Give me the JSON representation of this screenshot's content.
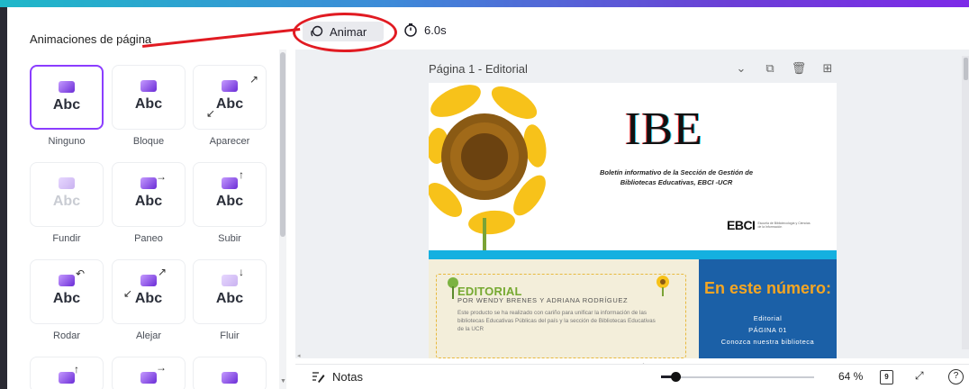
{
  "panel": {
    "title": "Animaciones de página",
    "animations": [
      {
        "label": "Ninguno",
        "preview": "Abc",
        "icon": "none-animation-icon",
        "selected": true
      },
      {
        "label": "Bloque",
        "preview": "Abc",
        "icon": "block-animation-icon",
        "selected": false
      },
      {
        "label": "Aparecer",
        "preview": "Abc",
        "icon": "appear-animation-icon",
        "selected": false
      },
      {
        "label": "Fundir",
        "preview": "Abc",
        "icon": "fade-animation-icon",
        "selected": false
      },
      {
        "label": "Paneo",
        "preview": "Abc",
        "icon": "pan-animation-icon",
        "selected": false
      },
      {
        "label": "Subir",
        "preview": "Abc",
        "icon": "rise-animation-icon",
        "selected": false
      },
      {
        "label": "Rodar",
        "preview": "Abc",
        "icon": "tumble-animation-icon",
        "selected": false
      },
      {
        "label": "Alejar",
        "preview": "Abc",
        "icon": "zoom-out-animation-icon",
        "selected": false
      },
      {
        "label": "Fluir",
        "preview": "Abc",
        "icon": "flow-animation-icon",
        "selected": false
      }
    ]
  },
  "toolbar": {
    "animate_label": "Animar",
    "duration": "6.0s"
  },
  "canvas": {
    "page_label": "Página 1 - Editorial",
    "title": "IBE",
    "subtitle": "Boletín informativo de la Sección de Gestión de Bibliotecas Educativas, EBCI -UCR",
    "logo_text": "EBCI",
    "logo_caption": "Escuela de Bibliotecología y Ciencias de la Información",
    "editorial_title": "EDITORIAL",
    "editorial_by": "POR WENDY BRENES Y ADRIANA RODRÍGUEZ",
    "editorial_text": "Este producto se ha realizado con cariño para unificar la información de las bibliotecas Educativas Públicas del país y la sección de Bibliotecas Educativas de la UCR",
    "contents_title": "En este número:",
    "contents_item1": "Editorial",
    "contents_item2": "PÁGINA 01",
    "contents_item3": "Conozca nuestra biblioteca"
  },
  "footer": {
    "notes_label": "Notas",
    "zoom": "64 %",
    "page_count": "9"
  },
  "colors": {
    "accent": "#8b3dff",
    "annotation_red": "#e11b22",
    "cover_blue": "#1b60a7",
    "cover_teal": "#14b0e0",
    "cover_orange": "#f5a623",
    "editorial_green": "#76a931"
  }
}
